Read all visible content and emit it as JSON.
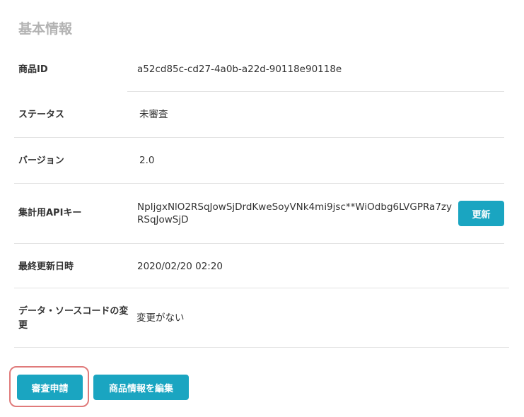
{
  "section": {
    "title": "基本情報"
  },
  "rows": [
    {
      "label": "商品ID",
      "value": "a52cd85c-cd27-4a0b-a22d-90118e90118e"
    },
    {
      "label": "ステータス",
      "value": "未審査"
    },
    {
      "label": "バージョン",
      "value": "2.0"
    },
    {
      "label": "集計用APIキー",
      "value_line1": "NpIjgxNlO2RSqJowSjDrdKweSoyVNk4mi9jsc**WiOdbg6LVGPRa7zy",
      "value_line2": "RSqJowSjD"
    },
    {
      "label": "最終更新日時",
      "value": "2020/02/20 02:20"
    },
    {
      "label_line1": "データ・ソースコードの変",
      "label_line2": "更",
      "value": "変更がない"
    }
  ],
  "buttons": {
    "refresh": "更新",
    "submit_review": "審査申請",
    "edit_product": "商品情報を編集"
  }
}
